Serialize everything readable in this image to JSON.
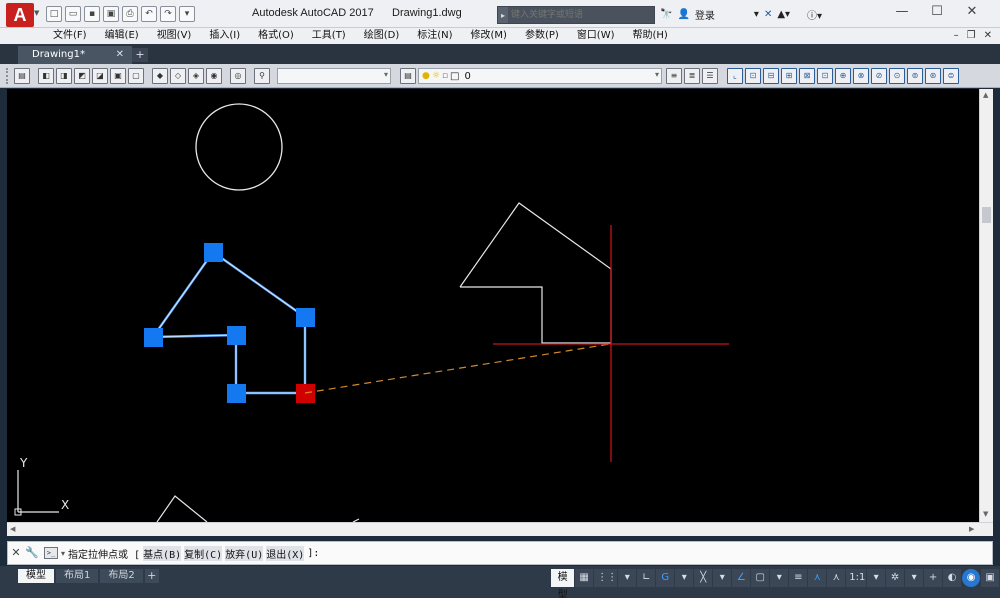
{
  "title_bar": {
    "logo": "A",
    "app_title": "Autodesk AutoCAD 2017",
    "file_name": "Drawing1.dwg",
    "search_placeholder": "键入关键字或短语",
    "login_label": "登录"
  },
  "menu": {
    "items": [
      "文件(F)",
      "编辑(E)",
      "视图(V)",
      "插入(I)",
      "格式(O)",
      "工具(T)",
      "绘图(D)",
      "标注(N)",
      "修改(M)",
      "参数(P)",
      "窗口(W)",
      "帮助(H)"
    ]
  },
  "doc_tabs": {
    "active_tab": "Drawing1*"
  },
  "toolbar": {
    "layer_name": "0"
  },
  "command_line": {
    "prompt": "指定拉伸点或 [",
    "options": [
      "基点(B)",
      "复制(C)",
      "放弃(U)",
      "退出(X)"
    ],
    "suffix": "]:"
  },
  "status_bar": {
    "layout_tabs": [
      "模型",
      "布局1",
      "布局2"
    ],
    "model_label": "模型",
    "scale_label": "1:1"
  },
  "colors": {
    "grip_selected": "#1479f0",
    "grip_hot": "#d10000",
    "selected_line": "#5fa8ff",
    "crosshair": "#c4121a",
    "rubberband": "#d08a2c",
    "geometry": "#e8e8e8"
  },
  "icons": [
    "autocad-logo",
    "search-icon",
    "binoculars-icon",
    "user-icon",
    "exchange-icon",
    "help-icon",
    "close-icon",
    "wrench-icon",
    "command-icon",
    "gear-icon",
    "plus-icon",
    "fullscreen-icon"
  ]
}
